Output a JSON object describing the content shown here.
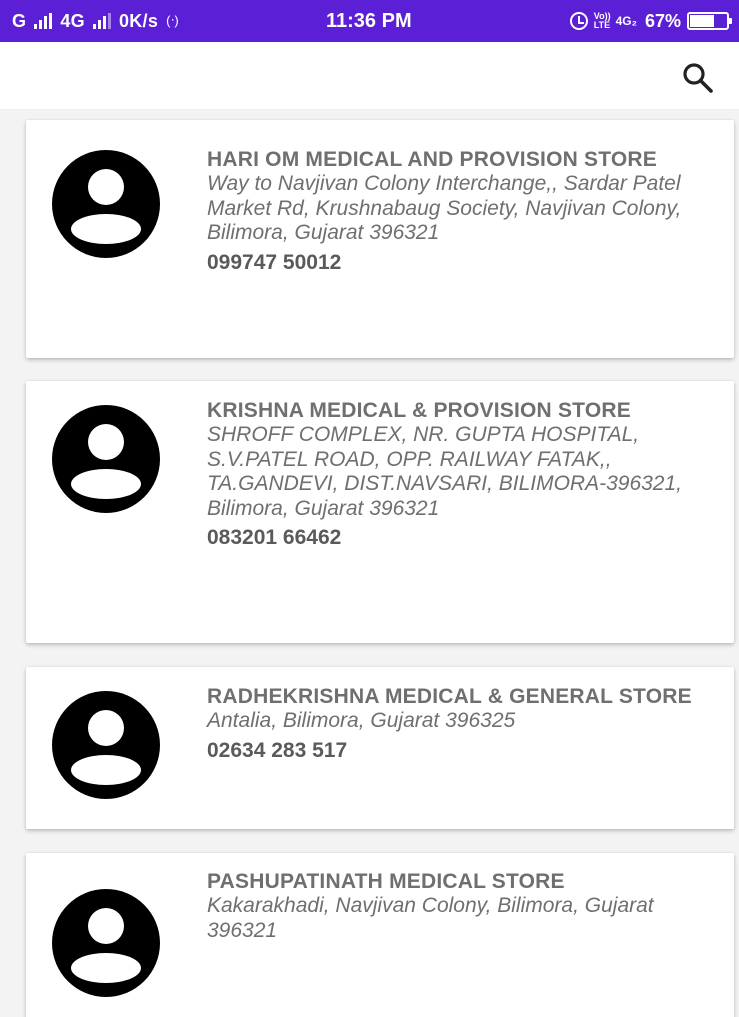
{
  "status_bar": {
    "carrier1": "G",
    "carrier2": "4G",
    "speed": "0K/s",
    "hotspot": "(ᐧ)",
    "time": "11:36 PM",
    "volte_top": "Vo))",
    "volte_bottom": "LTE",
    "net": "4G₂",
    "battery": "67%",
    "battery_level": 0.67,
    "accent_color": "#5b1fd6"
  },
  "app_bar": {
    "search_icon": "search-icon"
  },
  "stores": [
    {
      "name": "HARI OM MEDICAL AND PROVISION STORE",
      "address": "Way to Navjivan Colony Interchange,, Sardar Patel Market Rd, Krushnabaug Society, Navjivan Colony, Bilimora, Gujarat 396321",
      "phone": " 099747 50012",
      "icon": "account-circle-icon"
    },
    {
      "name": "KRISHNA MEDICAL & PROVISION STORE",
      "address": "SHROFF COMPLEX, NR. GUPTA HOSPITAL, S.V.PATEL ROAD, OPP. RAILWAY FATAK,, TA.GANDEVI, DIST.NAVSARI, BILIMORA-396321, Bilimora, Gujarat 396321",
      "phone": "083201 66462",
      "icon": "account-circle-icon"
    },
    {
      "name": "RADHEKRISHNA MEDICAL & GENERAL STORE",
      "address": "Antalia, Bilimora, Gujarat 396325",
      "phone": "02634 283 517",
      "icon": "account-circle-icon"
    },
    {
      "name": "PASHUPATINATH MEDICAL STORE",
      "address": "Kakarakhadi, Navjivan Colony, Bilimora, Gujarat 396321",
      "phone": "",
      "icon": "account-circle-icon"
    }
  ]
}
